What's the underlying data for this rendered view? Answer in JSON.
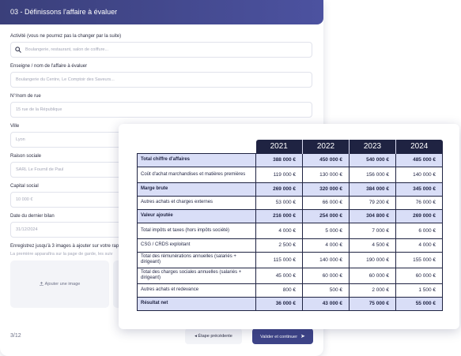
{
  "form": {
    "title": "03 - Définissons l'affaire à évaluer",
    "fields": [
      {
        "label": "Activité (vous ne pourrez pas la changer par la suite)",
        "placeholder": "Boulangerie, restaurant, salon de coiffure..."
      },
      {
        "label": "Enseigne / nom de l'affaire à évaluer",
        "placeholder": "Boulangerie du Centre, Le Comptoir des Saveurs..."
      },
      {
        "label": "N°/nom de rue",
        "placeholder": "15 rue de la République"
      },
      {
        "label": "Ville",
        "placeholder": "Lyon"
      },
      {
        "label": "Raison sociale",
        "placeholder": "SARL Le Fournil de Paul"
      },
      {
        "label": "Capital social",
        "placeholder": "10 000 €"
      },
      {
        "label": "Date du dernier bilan",
        "placeholder": "31/12/2024"
      }
    ],
    "images_label": "Enregistrez jusqu'à 3 images à ajouter sur votre rapp",
    "images_help": "La première apparaîtra sur la page de garde, les suiv",
    "upload_label": "Ajouter une image",
    "step_counter": "3/12",
    "prev_button": "Étape précédente",
    "next_button": "Valider et continuer",
    "icons": {
      "search": "search-icon",
      "upload": "upload-icon",
      "prev": "arrow-left-icon",
      "next": "send-arrow-icon"
    },
    "colors": {
      "header": "#3e4488",
      "primary_button": "#3e4488"
    }
  },
  "financial_table": {
    "years": [
      "2021",
      "2022",
      "2023",
      "2024"
    ],
    "rows": [
      {
        "label": "Total chiffre d'affaires",
        "values": [
          "388 000 €",
          "450 000 €",
          "540 000 €",
          "485 000 €"
        ],
        "highlight": true
      },
      {
        "label": "Coût d'achat marchandises et matières premières",
        "values": [
          "119 000 €",
          "130 000 €",
          "156 000 €",
          "140 000 €"
        ],
        "highlight": false
      },
      {
        "label": "Marge brute",
        "values": [
          "269 000 €",
          "320 000 €",
          "384 000 €",
          "345 000 €"
        ],
        "highlight": true
      },
      {
        "label": "Autres achats et charges externes",
        "values": [
          "53 000 €",
          "66 000 €",
          "79 200 €",
          "76 000 €"
        ],
        "highlight": false
      },
      {
        "label": "Valeur ajoutée",
        "values": [
          "216 000 €",
          "254 000 €",
          "304 800 €",
          "269 000 €"
        ],
        "highlight": true
      },
      {
        "label": "Total impôts et taxes (hors impôts société)",
        "values": [
          "4 000 €",
          "5 000 €",
          "7 000 €",
          "6 000 €"
        ],
        "highlight": false
      },
      {
        "label": "CSG / CRDS exploitant",
        "values": [
          "2 500 €",
          "4 000 €",
          "4 500 €",
          "4 000 €"
        ],
        "highlight": false
      },
      {
        "label": "Total des rémunérations annuelles (salariés + dirigeant)",
        "values": [
          "115 000 €",
          "140 000 €",
          "190 000 €",
          "155 000 €"
        ],
        "highlight": false
      },
      {
        "label": "Total des charges sociales annuelles (salariés + dirigeant)",
        "values": [
          "45 000 €",
          "60 000 €",
          "60 000 €",
          "60 000 €"
        ],
        "highlight": false
      },
      {
        "label": "Autres achats et redevance",
        "values": [
          "800 €",
          "500 €",
          "2 000 €",
          "1 500 €"
        ],
        "highlight": false
      },
      {
        "label": "Résultat net",
        "values": [
          "36 000 €",
          "43 000 €",
          "75 000 €",
          "55 000 €"
        ],
        "highlight": true
      }
    ],
    "colors": {
      "year_header": "#1f2342",
      "highlight_row": "#d9def7"
    }
  }
}
